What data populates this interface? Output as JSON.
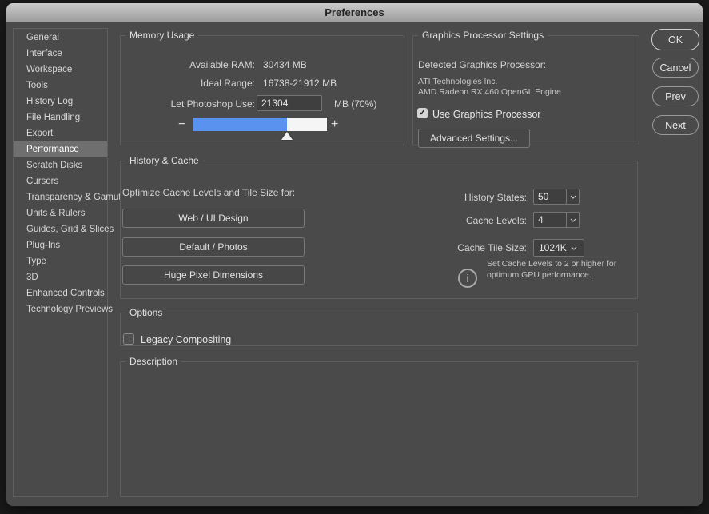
{
  "window": {
    "title": "Preferences"
  },
  "sidebar": {
    "items": [
      {
        "label": "General",
        "selected": false
      },
      {
        "label": "Interface",
        "selected": false
      },
      {
        "label": "Workspace",
        "selected": false
      },
      {
        "label": "Tools",
        "selected": false
      },
      {
        "label": "History Log",
        "selected": false
      },
      {
        "label": "File Handling",
        "selected": false
      },
      {
        "label": "Export",
        "selected": false
      },
      {
        "label": "Performance",
        "selected": true
      },
      {
        "label": "Scratch Disks",
        "selected": false
      },
      {
        "label": "Cursors",
        "selected": false
      },
      {
        "label": "Transparency & Gamut",
        "selected": false
      },
      {
        "label": "Units & Rulers",
        "selected": false
      },
      {
        "label": "Guides, Grid & Slices",
        "selected": false
      },
      {
        "label": "Plug-Ins",
        "selected": false
      },
      {
        "label": "Type",
        "selected": false
      },
      {
        "label": "3D",
        "selected": false
      },
      {
        "label": "Enhanced Controls",
        "selected": false
      },
      {
        "label": "Technology Previews",
        "selected": false
      }
    ]
  },
  "memory": {
    "section_title": "Memory Usage",
    "available_ram_label": "Available RAM:",
    "available_ram_value": "30434 MB",
    "ideal_range_label": "Ideal Range:",
    "ideal_range_value": "16738-21912 MB",
    "let_use_label": "Let Photoshop Use:",
    "let_use_value": "21304",
    "let_use_suffix": "MB (70%)",
    "slider": {
      "percent": 70,
      "minus_label": "−",
      "plus_label": "+"
    }
  },
  "gpu": {
    "section_title": "Graphics Processor Settings",
    "detected_label": "Detected Graphics Processor:",
    "vendor": "ATI Technologies Inc.",
    "device": "AMD Radeon RX 460 OpenGL Engine",
    "use_gpu_label": "Use Graphics Processor",
    "use_gpu_checked": true,
    "advanced_button": "Advanced Settings..."
  },
  "history_cache": {
    "section_title": "History & Cache",
    "optimize_label": "Optimize Cache Levels and Tile Size for:",
    "preset_buttons": [
      "Web / UI Design",
      "Default / Photos",
      "Huge Pixel Dimensions"
    ],
    "history_states_label": "History States:",
    "history_states_value": "50",
    "cache_levels_label": "Cache Levels:",
    "cache_levels_value": "4",
    "cache_tile_label": "Cache Tile Size:",
    "cache_tile_value": "1024K",
    "gpu_tip_line1": "Set Cache Levels to 2 or higher for",
    "gpu_tip_line2": "optimum GPU performance."
  },
  "options": {
    "section_title": "Options",
    "legacy_label": "Legacy Compositing",
    "legacy_checked": false
  },
  "description": {
    "section_title": "Description"
  },
  "actions": {
    "ok": "OK",
    "cancel": "Cancel",
    "prev": "Prev",
    "next": "Next"
  },
  "icons": {
    "check": "✓",
    "info": "i"
  },
  "colors": {
    "slider_fill": "#5a92f0",
    "slider_empty": "#f5f5f5",
    "selected_item_bg": "#6f6f6f",
    "dialog_bg": "#4a4a4a"
  }
}
